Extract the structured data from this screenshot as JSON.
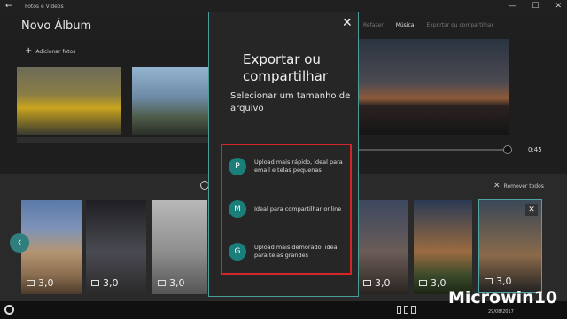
{
  "window": {
    "title": "Fotos e Vídeos",
    "back_glyph": "←",
    "min_glyph": "—",
    "max_glyph": "☐",
    "close_glyph": "✕"
  },
  "header": {
    "album_title": "Novo Álbum",
    "redo_label": "Refazer",
    "music_label": "Música",
    "export_label": "Exportar ou compartilhar"
  },
  "storyboard": {
    "add_photos_label": "Adicionar fotos",
    "add_glyph": "+"
  },
  "preview": {
    "time": "0:45"
  },
  "strip": {
    "remove_all_label": "Remover todos",
    "remove_glyph": "✕",
    "items": [
      {
        "duration": "3,0"
      },
      {
        "duration": "3,0"
      },
      {
        "duration": "3,0"
      },
      {
        "duration": "3,0"
      },
      {
        "duration": "3,0"
      },
      {
        "duration": "3,0"
      }
    ],
    "prev_glyph": "‹",
    "close_glyph": "✕"
  },
  "modal": {
    "close_glyph": "✕",
    "title": "Exportar ou compartilhar",
    "subtitle": "Selecionar um tamanho de arquivo",
    "options": [
      {
        "badge": "P",
        "text": "Upload mais rápido, ideal para email e telas pequenas"
      },
      {
        "badge": "M",
        "text": "Ideal para compartilhar online"
      },
      {
        "badge": "G",
        "text": "Upload mais demorado, ideal para telas grandes"
      }
    ]
  },
  "taskbar": {
    "date": "29/08/2017"
  },
  "watermark": "Microwin10",
  "colors": {
    "accent": "#1a7f7a",
    "highlight_border": "#d4252a",
    "modal_border": "#4a9c96"
  }
}
